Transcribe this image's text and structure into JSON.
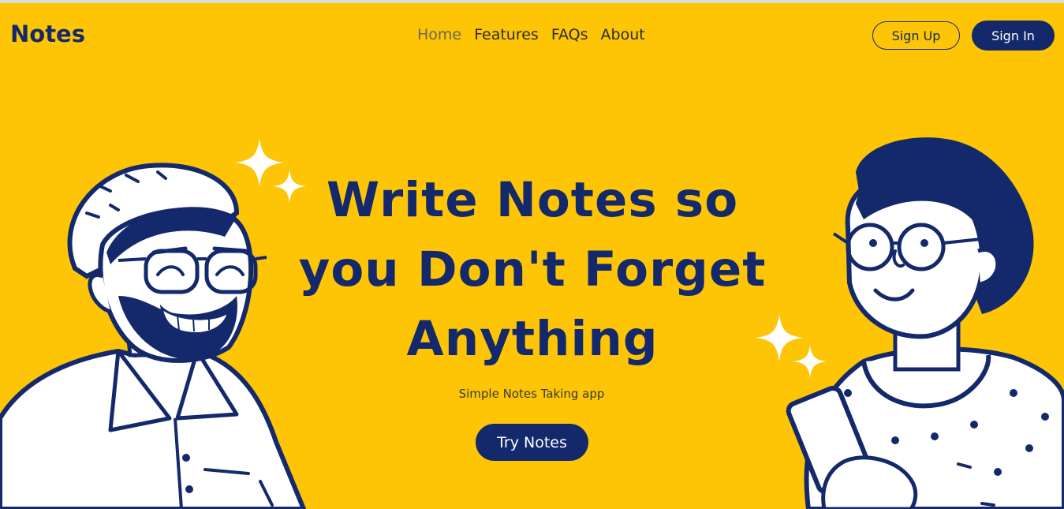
{
  "app": {
    "logo": "Notes"
  },
  "nav": {
    "items": [
      "Home",
      "Features",
      "FAQs",
      "About"
    ],
    "active": "Home"
  },
  "auth": {
    "signup_label": "Sign Up",
    "signin_label": "Sign In"
  },
  "hero": {
    "title_line1": "Write Notes so",
    "title_line2": "you Don't Forget",
    "title_line3": "Anything",
    "subtitle": "Simple Notes Taking app",
    "cta_label": "Try Notes"
  },
  "colors": {
    "background": "#fdc505",
    "brand_navy": "#14296b",
    "white": "#ffffff"
  },
  "icons": [
    "sparkle-icon",
    "sparkle-icon",
    "sparkle-icon",
    "sparkle-icon"
  ]
}
